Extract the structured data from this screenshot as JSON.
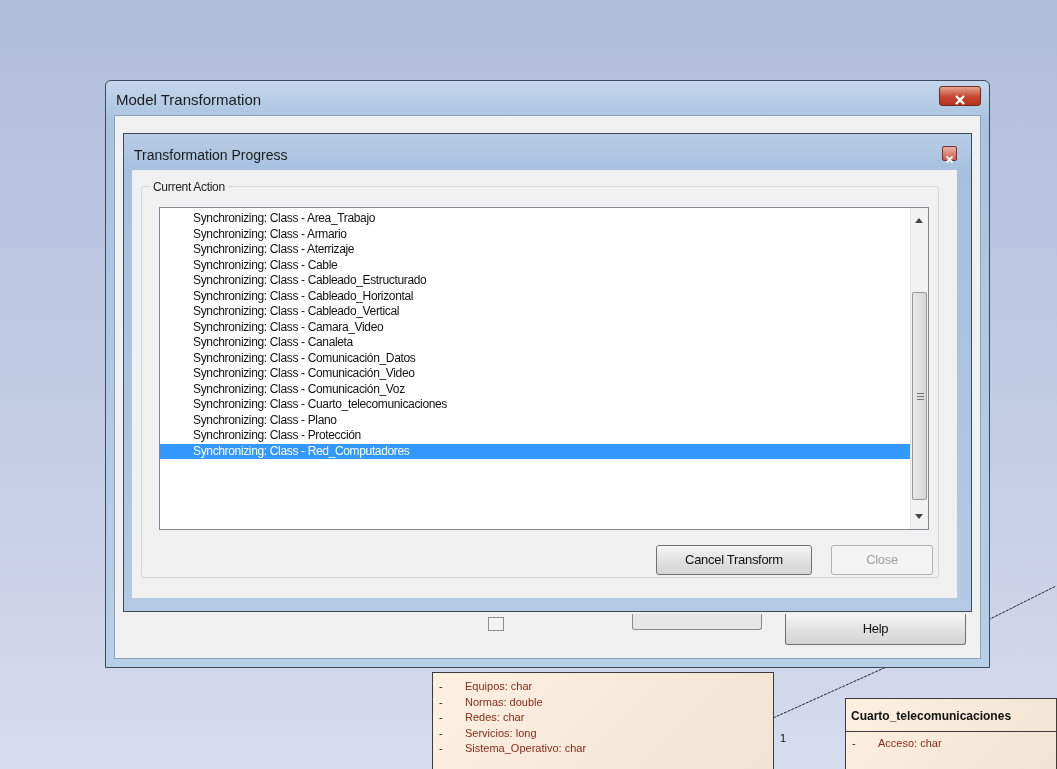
{
  "outer_dialog": {
    "title": "Model Transformation",
    "checkbox": {
      "checked": false
    },
    "buttons": [
      {
        "label": "Help",
        "disabled": false
      }
    ]
  },
  "progress_dialog": {
    "title": "Transformation Progress",
    "group_label": "Current Action",
    "log": [
      {
        "text": "Synchronizing: Class - Area_Trabajo",
        "selected": false
      },
      {
        "text": "Synchronizing: Class - Armario",
        "selected": false
      },
      {
        "text": "Synchronizing: Class - Aterrizaje",
        "selected": false
      },
      {
        "text": "Synchronizing: Class - Cable",
        "selected": false
      },
      {
        "text": "Synchronizing: Class - Cableado_Estructurado",
        "selected": false
      },
      {
        "text": "Synchronizing: Class - Cableado_Horizontal",
        "selected": false
      },
      {
        "text": "Synchronizing: Class - Cableado_Vertical",
        "selected": false
      },
      {
        "text": "Synchronizing: Class - Camara_Video",
        "selected": false
      },
      {
        "text": "Synchronizing: Class - Canaleta",
        "selected": false
      },
      {
        "text": "Synchronizing: Class - Comunicación_Datos",
        "selected": false
      },
      {
        "text": "Synchronizing: Class - Comunicación_Video",
        "selected": false
      },
      {
        "text": "Synchronizing: Class - Comunicación_Voz",
        "selected": false
      },
      {
        "text": "Synchronizing: Class - Cuarto_telecomunicaciones",
        "selected": false
      },
      {
        "text": "Synchronizing: Class - Plano",
        "selected": false
      },
      {
        "text": "Synchronizing: Class - Protección",
        "selected": false
      },
      {
        "text": "Synchronizing: Class - Red_Computadores",
        "selected": true
      }
    ],
    "buttons": [
      {
        "label": "Cancel Transform",
        "disabled": false
      },
      {
        "label": "Close",
        "disabled": true
      }
    ]
  },
  "diagram": {
    "classes": [
      {
        "attributes": [
          {
            "visibility": "-",
            "text": "Equipos: char"
          },
          {
            "visibility": "-",
            "text": "Normas: double"
          },
          {
            "visibility": "-",
            "text": "Redes: char"
          },
          {
            "visibility": "-",
            "text": "Servicios: long"
          },
          {
            "visibility": "-",
            "text": "Sistema_Operativo: char"
          }
        ]
      },
      {
        "name": "Cuarto_telecomunicaciones",
        "attributes": [
          {
            "visibility": "-",
            "text": "Acceso: char"
          }
        ]
      }
    ],
    "multiplicity": "1"
  }
}
